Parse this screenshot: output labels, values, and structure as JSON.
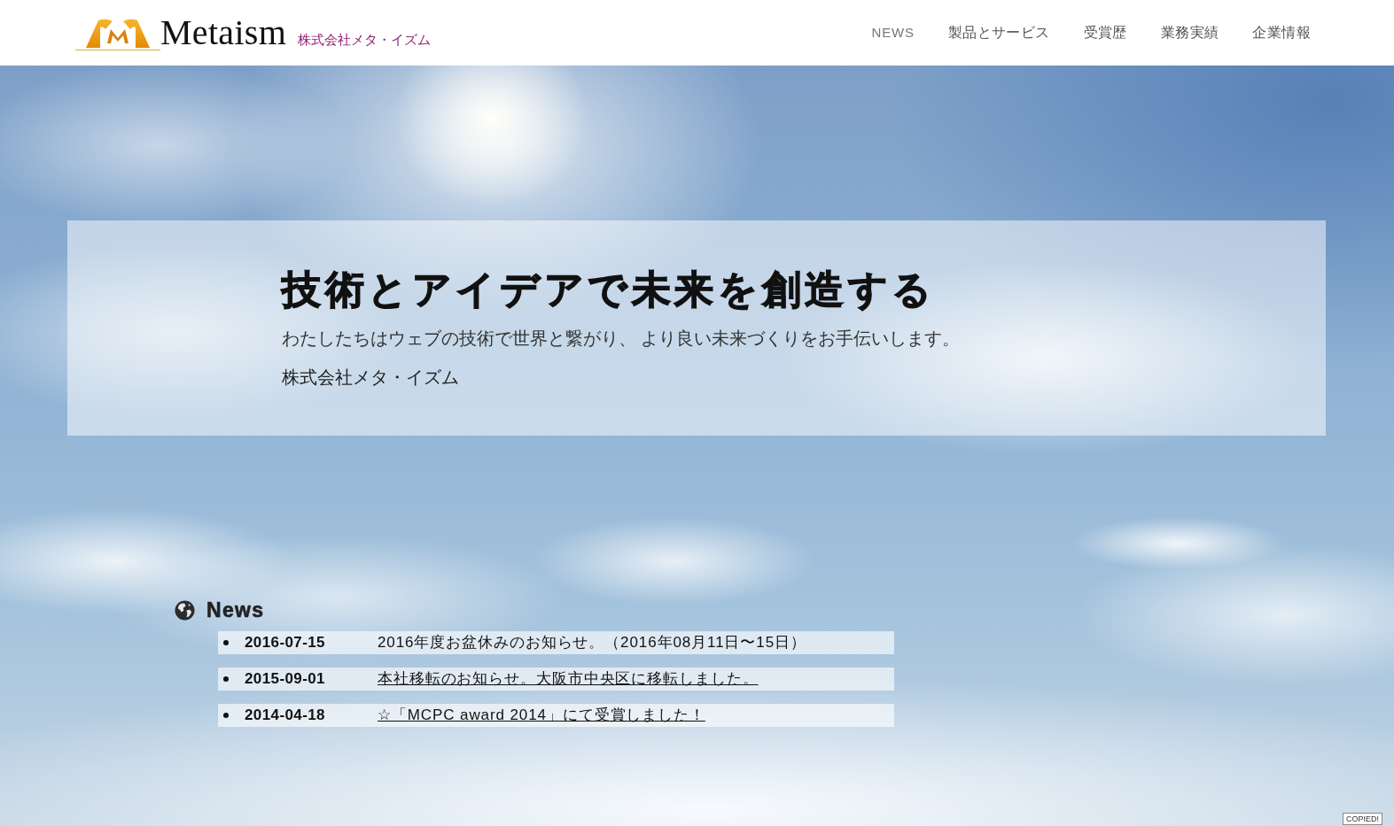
{
  "header": {
    "brand": "Metaism",
    "company": "株式会社メタ・イズム",
    "nav": [
      "NEWS",
      "製品とサービス",
      "受賞歴",
      "業務実績",
      "企業情報"
    ]
  },
  "hero": {
    "title": "技術とアイデアで未来を創造する",
    "subtitle": "わたしたちはウェブの技術で世界と繋がり、 より良い未来づくりをお手伝いします。",
    "company": "株式会社メタ・イズム"
  },
  "news": {
    "heading": "News",
    "items": [
      {
        "date": "2016-07-15",
        "text": "2016年度お盆休みのお知らせ。（2016年08月11日〜15日）",
        "linked": false
      },
      {
        "date": "2015-09-01",
        "text": "本社移転のお知らせ。大阪市中央区に移転しました。",
        "linked": true
      },
      {
        "date": "2014-04-18",
        "text": "☆「MCPC award 2014」にて受賞しました！",
        "linked": true
      }
    ]
  },
  "tooltip": {
    "text": "COPIED!"
  }
}
